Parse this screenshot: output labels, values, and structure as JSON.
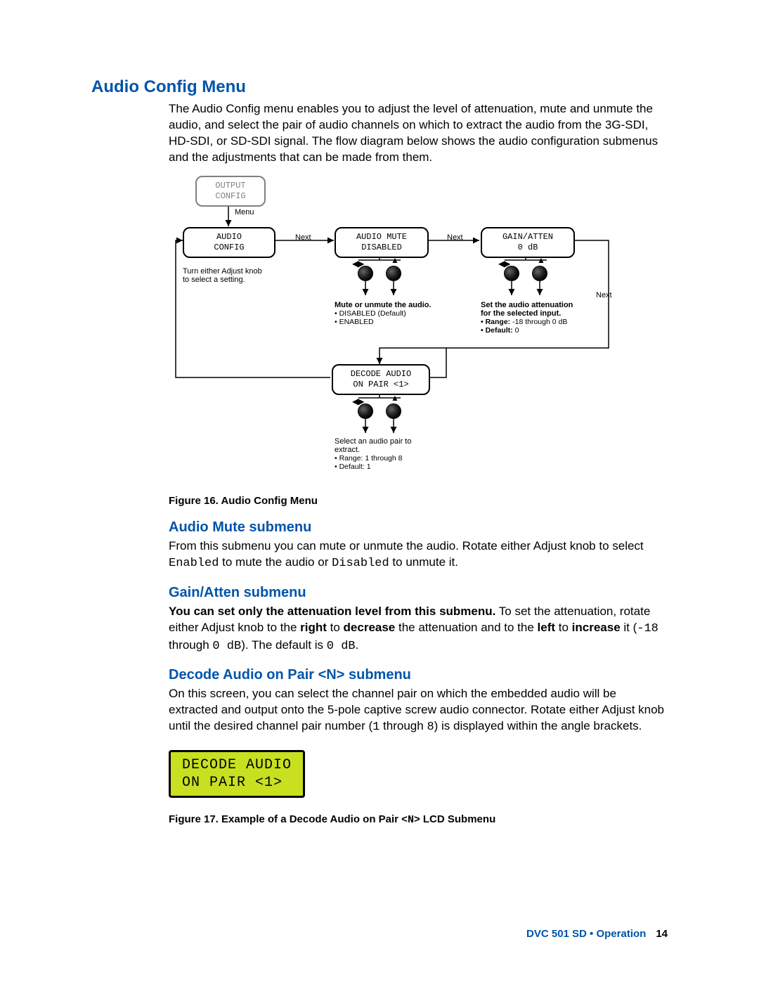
{
  "h1": "Audio Config Menu",
  "intro": "The Audio Config menu enables you to adjust the level of attenuation, mute and unmute the audio, and select the pair of audio channels on which to extract the audio from the 3G-SDI, HD-SDI, or SD-SDI signal. The flow diagram below shows the audio configuration submenus and the adjustments that can be made from them.",
  "diagram": {
    "output_config_l1": "OUTPUT",
    "output_config_l2": "CONFIG",
    "menu_label": "Menu",
    "audio_config_l1": "AUDIO",
    "audio_config_l2": "CONFIG",
    "next1": "Next",
    "audio_mute_l1": "AUDIO MUTE",
    "audio_mute_l2": "DISABLED",
    "next2": "Next",
    "gain_atten_l1": "GAIN/ATTEN",
    "gain_atten_l2": "0 dB",
    "next3": "Next",
    "turn_knob_l1": "Turn either Adjust knob",
    "turn_knob_l2": "to select a setting.",
    "mute_header": "Mute or unmute the audio.",
    "mute_b1": "• DISABLED (Default)",
    "mute_b2": "• ENABLED",
    "gain_header_l1": "Set the audio attenuation",
    "gain_header_l2": "for the selected input.",
    "gain_range_label": "•  Range:",
    "gain_range_value": "-18 through 0 dB",
    "gain_default_label": "•  Default:",
    "gain_default_value": "0",
    "decode_l1": "DECODE AUDIO",
    "decode_l2": "ON PAIR <1>",
    "pair_l1": "Select an audio pair to",
    "pair_l2": "extract.",
    "pair_range": "• Range: 1 through 8",
    "pair_default": "• Default: 1"
  },
  "fig16": "Figure 16.   Audio Config Menu",
  "h2_mute": "Audio Mute submenu",
  "mute_p_pre": "From this submenu you can mute or unmute the audio. Rotate either Adjust knob to select ",
  "mute_enabled": "Enabled",
  "mute_mid": " to mute the audio or ",
  "mute_disabled": "Disabled",
  "mute_end": " to unmute it.",
  "h2_gain": "Gain/Atten submenu",
  "gain_bold": "You can set only the attenuation level from this submenu.",
  "gain_rest1": " To set the attenuation, rotate either Adjust knob to the ",
  "gain_right": "right",
  "gain_rest2": " to ",
  "gain_decrease": "decrease",
  "gain_rest3": " the attenuation and to the ",
  "gain_left": "left",
  "gain_rest4": " to ",
  "gain_increase": "increase",
  "gain_rest5": " it (",
  "gain_min": "-18",
  "gain_rest6": " through ",
  "gain_max": "0 dB",
  "gain_rest7": "). The default is ",
  "gain_def": "0 dB",
  "gain_rest8": ".",
  "h2_decode": "Decode Audio on Pair <N> submenu",
  "decode_p_pre": "On this screen, you can select the channel pair on which the embedded audio will be extracted and output onto the 5-pole captive screw audio connector. Rotate either Adjust knob until the desired channel pair number (",
  "decode_min": "1",
  "decode_mid": " through ",
  "decode_max": "8",
  "decode_end": ") is displayed within the angle brackets.",
  "lcd_l1": "DECODE AUDIO",
  "lcd_l2": "ON PAIR <1>",
  "fig17_pre": "Figure 17.   Example of a Decode Audio on Pair <",
  "fig17_n": "N",
  "fig17_post": "> LCD Submenu",
  "footer_doc": "DVC 501 SD • Operation",
  "footer_page": "14"
}
